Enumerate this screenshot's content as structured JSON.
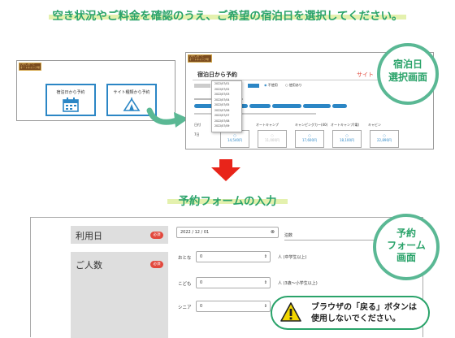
{
  "header": {
    "title": "空き状況やご料金を確認のうえ、ご希望の宿泊日を選択してください。"
  },
  "screen1": {
    "logo": "ひがしおーと\nオートキャンプ場",
    "buttons": [
      "宿泊日から予約",
      "サイト種類から予約"
    ]
  },
  "screen2": {
    "logo": "ひがしおーと\nオートキャンプ場",
    "title": "宿泊日から予約",
    "title_right": "サイト",
    "dropdown_items": [
      "2022/07/01",
      "2022/07/02",
      "2022/07/03",
      "2022/07/04",
      "2022/07/05",
      "2022/07/06",
      "2022/07/07",
      "2022/07/08",
      "2022/07/09"
    ],
    "radio": [
      "不使用",
      "使用あり"
    ],
    "columns": [
      "日付",
      "オートキャンプ",
      "キャンピングカー(40)",
      "オートキャンプ(電)",
      "キャビン"
    ],
    "prices": [
      "14,540円",
      "11,000円",
      "17,600円",
      "18,100円",
      "22,890円"
    ],
    "row_label": "7日"
  },
  "badge1": {
    "line1": "宿泊日",
    "line2": "選択画面"
  },
  "section2": {
    "title": "予約フォームの入力"
  },
  "form": {
    "date_label": "利用日",
    "people_label": "ご人数",
    "required": "必須",
    "date_value": "2022 / 12 / 01",
    "nights_unit": "泊数",
    "rows": [
      {
        "label": "おとな",
        "value": "0",
        "unit": "人 (中学生以上)"
      },
      {
        "label": "こども",
        "value": "0",
        "unit": "人 (3歳〜小学生以上)"
      },
      {
        "label": "シニア",
        "value": "0",
        "unit": ""
      }
    ]
  },
  "badge2": {
    "line1": "予約",
    "line2": "フォーム",
    "line3": "画面"
  },
  "warning": {
    "line1": "ブラウザの「戻る」ボタンは",
    "line2": "使用しないでください。"
  },
  "colors": {
    "accent": "#2aa36a",
    "ring": "#5ab894",
    "red": "#e8241a",
    "blue": "#2b86c5"
  }
}
